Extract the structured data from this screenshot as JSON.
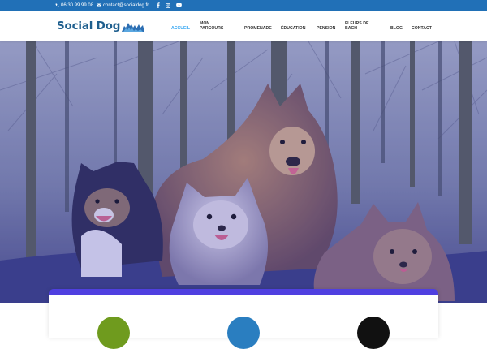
{
  "topbar": {
    "phone": "06 30 99 99 08",
    "email": "contact@socialdog.fr",
    "icons": [
      "phone-icon",
      "mail-icon",
      "facebook-icon",
      "instagram-icon",
      "youtube-icon"
    ]
  },
  "logo": {
    "text": "Social Dog",
    "icon": "dog-silhouette-icon"
  },
  "nav": {
    "items": [
      {
        "label": "ACCUEIL",
        "active": true
      },
      {
        "label": "MON PARCOURS"
      },
      {
        "label": "PROMENADE"
      },
      {
        "label": "ÉDUCATION"
      },
      {
        "label": "PENSION"
      },
      {
        "label": "FLEURS DE BACH"
      },
      {
        "label": "BLOG"
      },
      {
        "label": "CONTACT"
      }
    ]
  },
  "hero": {
    "image": "four-dogs-in-forest"
  },
  "colors": {
    "topbar": "#2170b7",
    "active_link": "#2ea3f2",
    "card_border": "#4f3fe0",
    "circle_1": "#6f9b1e",
    "circle_2": "#2a7ec0",
    "circle_3": "#111111"
  }
}
